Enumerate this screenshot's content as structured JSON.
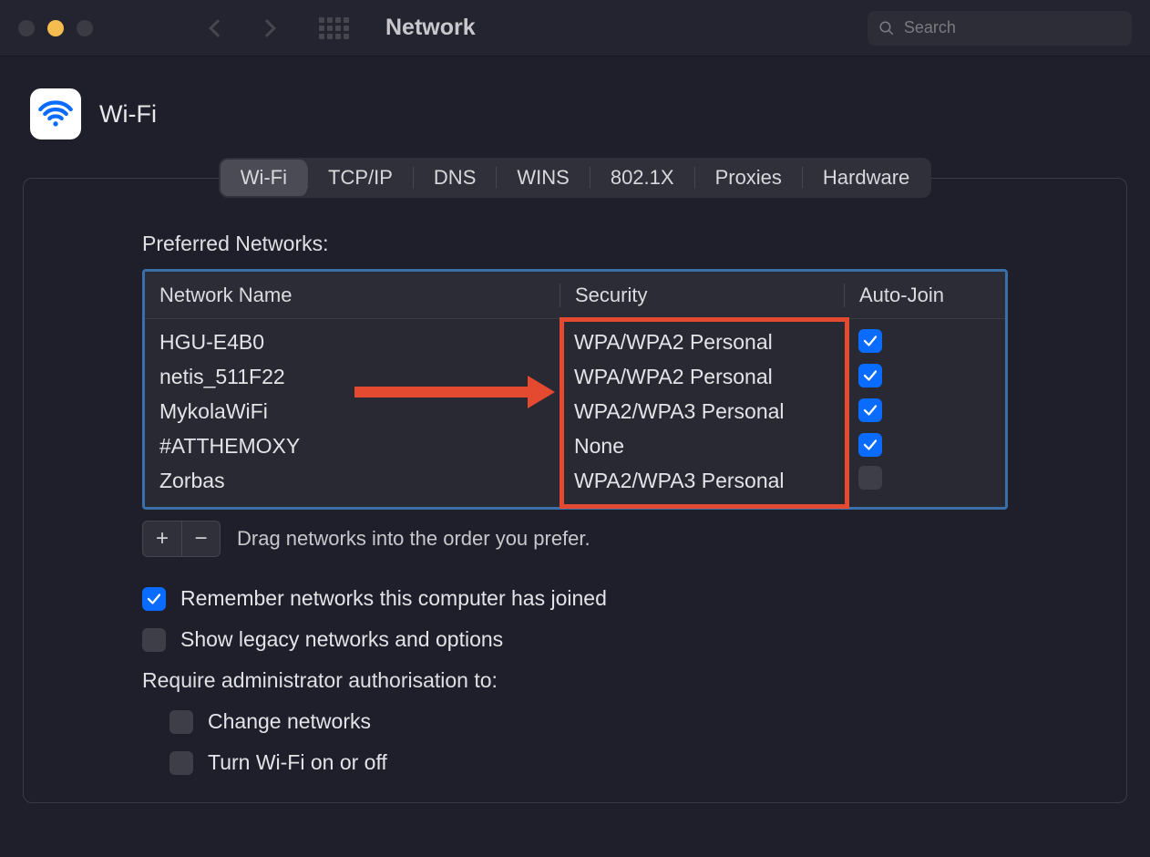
{
  "window": {
    "title": "Network"
  },
  "search": {
    "placeholder": "Search"
  },
  "page": {
    "title": "Wi-Fi"
  },
  "tabs": [
    "Wi-Fi",
    "TCP/IP",
    "DNS",
    "WINS",
    "802.1X",
    "Proxies",
    "Hardware"
  ],
  "active_tab": 0,
  "section": {
    "label": "Preferred Networks:"
  },
  "columns": {
    "name": "Network Name",
    "security": "Security",
    "autojoin": "Auto-Join"
  },
  "networks": [
    {
      "name": "HGU-E4B0",
      "security": "WPA/WPA2 Personal",
      "autojoin": true
    },
    {
      "name": "netis_511F22",
      "security": "WPA/WPA2 Personal",
      "autojoin": true
    },
    {
      "name": "MykolaWiFi",
      "security": "WPA2/WPA3 Personal",
      "autojoin": true
    },
    {
      "name": "#ATTHEMOXY",
      "security": "None",
      "autojoin": true
    },
    {
      "name": "Zorbas",
      "security": "WPA2/WPA3 Personal",
      "autojoin": false
    }
  ],
  "toolbar": {
    "add": "+",
    "remove": "−",
    "hint": "Drag networks into the order you prefer."
  },
  "options": {
    "remember": {
      "label": "Remember networks this computer has joined",
      "checked": true
    },
    "legacy": {
      "label": "Show legacy networks and options",
      "checked": false
    },
    "admin_heading": "Require administrator authorisation to:",
    "change_nets": {
      "label": "Change networks",
      "checked": false
    },
    "toggle_wifi": {
      "label": "Turn Wi-Fi on or off",
      "checked": false
    }
  },
  "annotation": {
    "highlight_column": "security",
    "arrow_target_row": 1
  }
}
